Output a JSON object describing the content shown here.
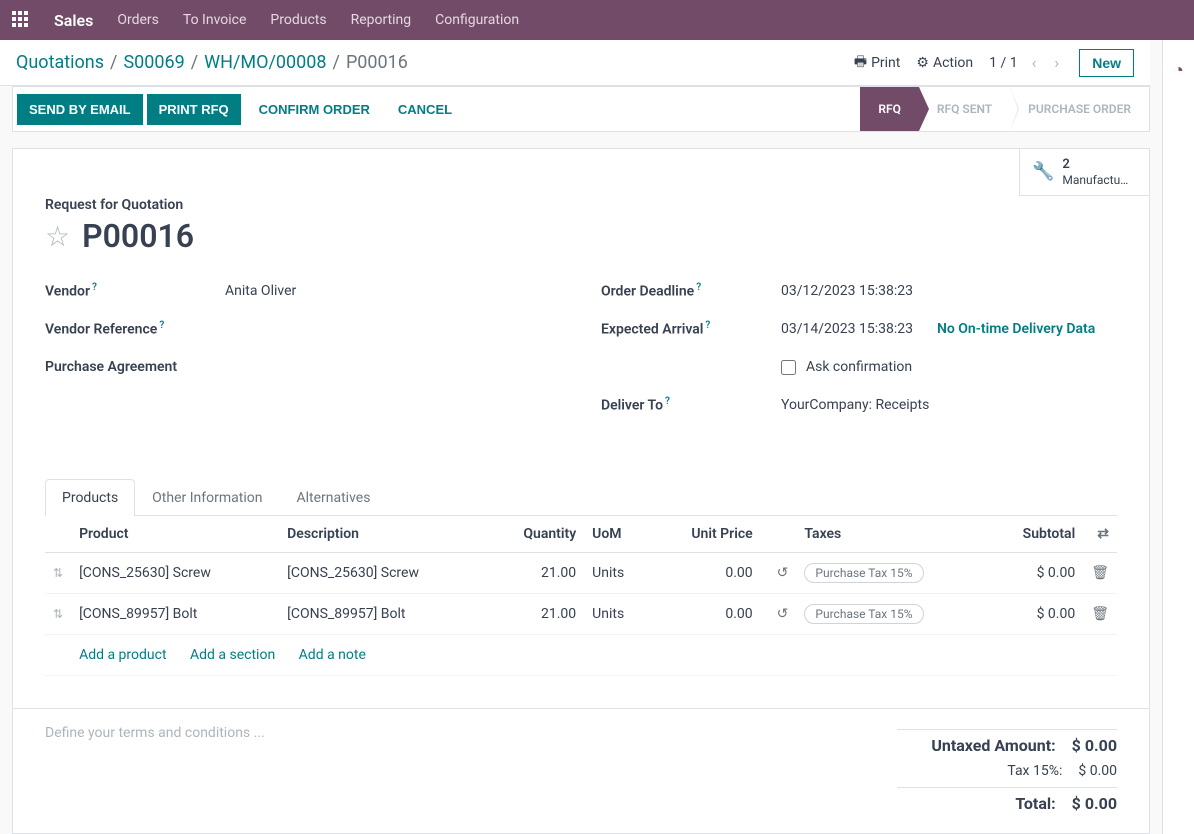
{
  "topbar": {
    "brand": "Sales",
    "menu": [
      "Orders",
      "To Invoice",
      "Products",
      "Reporting",
      "Configuration"
    ]
  },
  "breadcrumb": {
    "items": [
      "Quotations",
      "S00069",
      "WH/MO/00008"
    ],
    "current": "P00016"
  },
  "controls": {
    "print": "Print",
    "action": "Action",
    "pager": "1 / 1",
    "new": "New"
  },
  "actions": {
    "send_email": "SEND BY EMAIL",
    "print_rfq": "PRINT RFQ",
    "confirm": "CONFIRM ORDER",
    "cancel": "CANCEL"
  },
  "status": {
    "steps": [
      "RFQ",
      "RFQ SENT",
      "PURCHASE ORDER"
    ],
    "active_index": 0
  },
  "stat_button": {
    "value": "2",
    "label": "Manufactu…"
  },
  "title": {
    "subtitle": "Request for Quotation",
    "name": "P00016"
  },
  "fields": {
    "vendor_label": "Vendor",
    "vendor_value": "Anita Oliver",
    "vendor_ref_label": "Vendor Reference",
    "vendor_ref_value": "",
    "purchase_agreement_label": "Purchase Agreement",
    "purchase_agreement_value": "",
    "order_deadline_label": "Order Deadline",
    "order_deadline_value": "03/12/2023 15:38:23",
    "expected_arrival_label": "Expected Arrival",
    "expected_arrival_value": "03/14/2023 15:38:23",
    "no_ontime_data": "No On-time Delivery Data",
    "ask_confirmation_label": "Ask confirmation",
    "deliver_to_label": "Deliver To",
    "deliver_to_value": "YourCompany: Receipts"
  },
  "tabs": [
    "Products",
    "Other Information",
    "Alternatives"
  ],
  "table": {
    "headers": {
      "product": "Product",
      "description": "Description",
      "quantity": "Quantity",
      "uom": "UoM",
      "unit_price": "Unit Price",
      "taxes": "Taxes",
      "subtotal": "Subtotal"
    },
    "rows": [
      {
        "product": "[CONS_25630] Screw",
        "description": "[CONS_25630] Screw",
        "quantity": "21.00",
        "uom": "Units",
        "unit_price": "0.00",
        "tax": "Purchase Tax 15%",
        "subtotal": "$ 0.00"
      },
      {
        "product": "[CONS_89957] Bolt",
        "description": "[CONS_89957] Bolt",
        "quantity": "21.00",
        "uom": "Units",
        "unit_price": "0.00",
        "tax": "Purchase Tax 15%",
        "subtotal": "$ 0.00"
      }
    ],
    "add_product": "Add a product",
    "add_section": "Add a section",
    "add_note": "Add a note"
  },
  "terms_placeholder": "Define your terms and conditions ...",
  "totals": {
    "untaxed_label": "Untaxed Amount:",
    "untaxed_value": "$ 0.00",
    "tax_label": "Tax 15%:",
    "tax_value": "$ 0.00",
    "total_label": "Total:",
    "total_value": "$ 0.00"
  }
}
